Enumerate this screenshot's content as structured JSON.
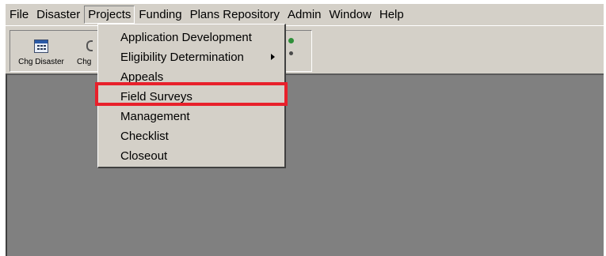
{
  "menubar": {
    "items": [
      "File",
      "Disaster",
      "Projects",
      "Funding",
      "Plans Repository",
      "Admin",
      "Window",
      "Help"
    ],
    "open_item": "Projects"
  },
  "toolbar": {
    "buttons": [
      {
        "label": "Chg Disaster",
        "icon": "calendar-icon"
      },
      {
        "label": "Chg",
        "icon": "partial-icon"
      }
    ]
  },
  "projects_menu": {
    "items": [
      {
        "label": "Application Development",
        "submenu": false
      },
      {
        "label": "Eligibility Determination",
        "submenu": true
      },
      {
        "label": "Appeals",
        "submenu": false
      },
      {
        "label": "Field Surveys",
        "submenu": false
      },
      {
        "label": "Management",
        "submenu": false
      },
      {
        "label": "Checklist",
        "submenu": false
      },
      {
        "label": "Closeout",
        "submenu": false
      }
    ],
    "highlighted_item": "Field Surveys"
  },
  "colors": {
    "chrome": "#d4d0c8",
    "workspace": "#808080",
    "highlight_border": "#e8202b"
  }
}
